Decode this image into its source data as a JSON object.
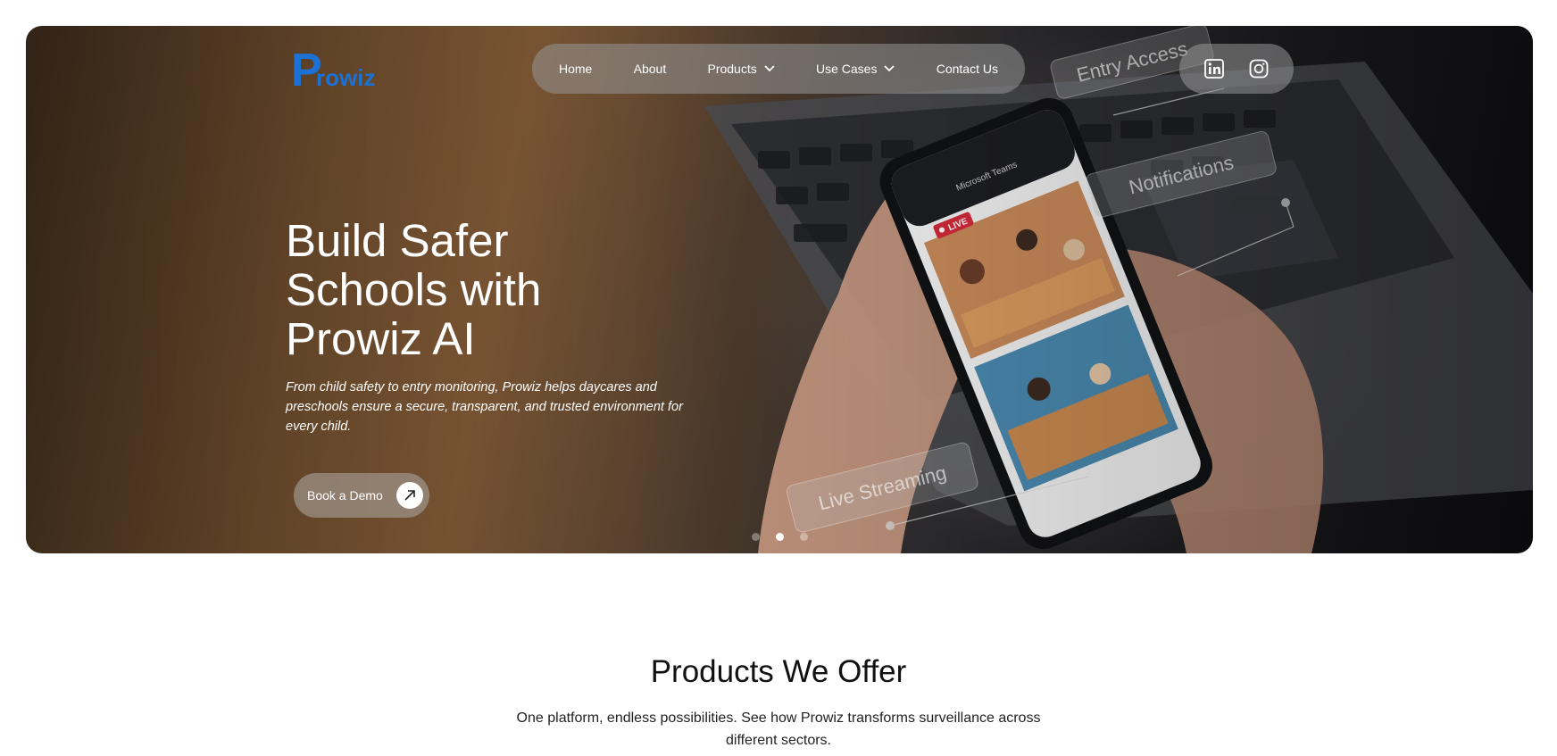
{
  "brand": {
    "logo_mark": "P",
    "logo_text": "rowiz",
    "color": "#1b72d4"
  },
  "nav": {
    "items": [
      {
        "label": "Home",
        "has_dropdown": false
      },
      {
        "label": "About",
        "has_dropdown": false
      },
      {
        "label": "Products",
        "has_dropdown": true
      },
      {
        "label": "Use Cases",
        "has_dropdown": true
      },
      {
        "label": "Contact Us",
        "has_dropdown": false
      }
    ]
  },
  "social": {
    "icons": [
      "linkedin-icon",
      "instagram-icon"
    ]
  },
  "hero": {
    "headline": "Build Safer Schools with Prowiz AI",
    "subtext": "From child safety to entry monitoring, Prowiz helps daycares and preschools ensure a secure, transparent, and trusted environment for every child.",
    "cta_label": "Book a Demo",
    "feature_tags": [
      "Entry Access",
      "Notifications",
      "Live Streaming"
    ],
    "phone_app": "Microsoft Teams",
    "live_badge": "LIVE",
    "slides_total": 3,
    "slide_active": 2
  },
  "products_section": {
    "title": "Products We Offer",
    "subtitle": "One platform, endless possibilities. See how Prowiz transforms surveillance across different sectors."
  }
}
